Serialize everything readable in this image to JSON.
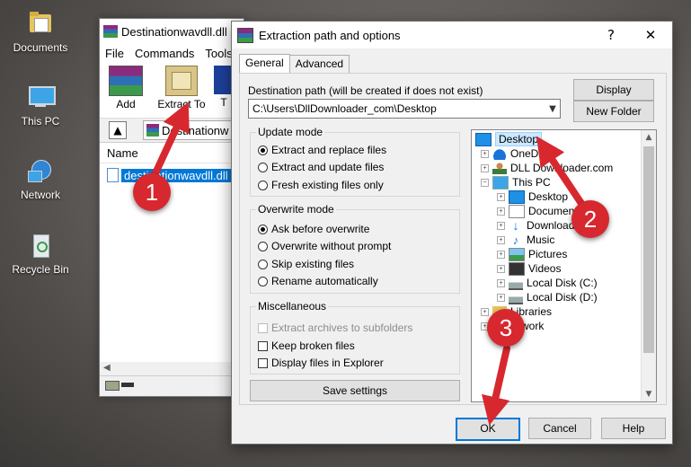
{
  "desktop": {
    "icons": [
      {
        "label": "Documents",
        "icon": "folder-documents-icon"
      },
      {
        "label": "This PC",
        "icon": "computer-icon"
      },
      {
        "label": "Network",
        "icon": "network-icon"
      },
      {
        "label": "Recycle Bin",
        "icon": "recycle-bin-icon"
      }
    ]
  },
  "background_window": {
    "title": "Destinationwavdll.dll",
    "menu": [
      "File",
      "Commands",
      "Tools"
    ],
    "toolbar": [
      {
        "label": "Add"
      },
      {
        "label": "Extract To"
      },
      {
        "label": "T"
      }
    ],
    "address": "Destinationw",
    "column_header": "Name",
    "selected_file": "destinationwavdll.dll"
  },
  "dialog": {
    "title": "Extraction path and options",
    "help_glyph": "?",
    "close_glyph": "✕",
    "tabs": [
      "General",
      "Advanced"
    ],
    "dest_label": "Destination path (will be created if does not exist)",
    "dest_value": "C:\\Users\\DllDownloader_com\\Desktop",
    "display_button": "Display",
    "new_folder_button": "New Folder",
    "update_mode": {
      "title": "Update mode",
      "options": [
        "Extract and replace files",
        "Extract and update files",
        "Fresh existing files only"
      ],
      "selected": 0
    },
    "overwrite_mode": {
      "title": "Overwrite mode",
      "options": [
        "Ask before overwrite",
        "Overwrite without prompt",
        "Skip existing files",
        "Rename automatically"
      ],
      "selected": 0
    },
    "misc": {
      "title": "Miscellaneous",
      "options": [
        {
          "label": "Extract archives to subfolders",
          "checked": false,
          "disabled": true
        },
        {
          "label": "Keep broken files",
          "checked": false,
          "disabled": false
        },
        {
          "label": "Display files in Explorer",
          "checked": false,
          "disabled": false
        }
      ]
    },
    "save_settings": "Save settings",
    "tree": [
      {
        "label": "Desktop",
        "icon": "desktop-icon",
        "selected": true
      },
      {
        "label": "OneDr",
        "icon": "onedrive-icon"
      },
      {
        "label": "DLL Downloader.com",
        "icon": "user-icon"
      },
      {
        "label": "This PC",
        "icon": "computer-icon"
      },
      {
        "label": "Desktop",
        "icon": "desktop-icon"
      },
      {
        "label": "Documents",
        "icon": "documents-icon"
      },
      {
        "label": "Downloads",
        "icon": "downloads-icon"
      },
      {
        "label": "Music",
        "icon": "music-icon"
      },
      {
        "label": "Pictures",
        "icon": "pictures-icon"
      },
      {
        "label": "Videos",
        "icon": "videos-icon"
      },
      {
        "label": "Local Disk (C:)",
        "icon": "disk-icon"
      },
      {
        "label": "Local Disk (D:)",
        "icon": "disk-icon"
      },
      {
        "label": "Libraries",
        "icon": "folder-icon"
      },
      {
        "label": "etwork",
        "icon": "network-icon"
      }
    ],
    "ok": "OK",
    "cancel": "Cancel",
    "help": "Help"
  },
  "annotations": {
    "badges": [
      "1",
      "2",
      "3"
    ],
    "color": "#d7282f"
  },
  "colors": {
    "selection": "#0078d7",
    "ok_border": "#0078d7"
  }
}
